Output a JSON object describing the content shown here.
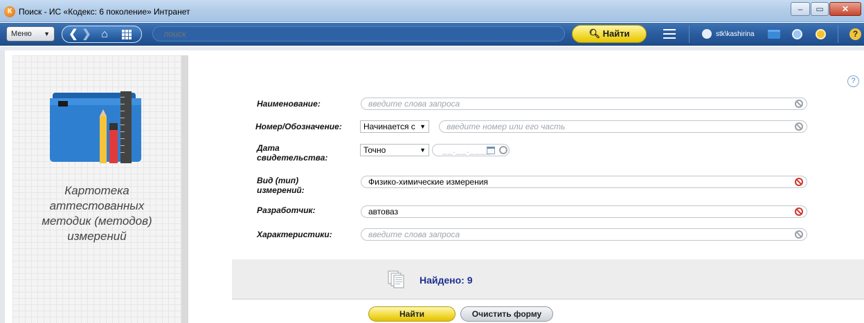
{
  "window": {
    "title": "Поиск - ИС «Кодекс: 6 поколение» Интранет",
    "app_icon_letter": "К"
  },
  "toolbar": {
    "menu_label": "Меню",
    "search_placeholder": "поиск",
    "find_label": "Найти",
    "user_name": "stk\\kashirina",
    "help_symbol": "?"
  },
  "side_panel": {
    "caption_lines": [
      "Картотека",
      "аттестованных",
      "методик (методов)",
      "измерений"
    ]
  },
  "form": {
    "name_label": "Наименование:",
    "name_placeholder": "введите слова запроса",
    "number_label": "Номер/Обозначение:",
    "number_mode": "Начинается с",
    "number_placeholder": "введите номер или его часть",
    "date_label_1": "Дата",
    "date_label_2": "свидетельства:",
    "date_mode": "Точно",
    "date_mask": "__.__.____",
    "kind_label_1": "Вид (тип)",
    "kind_label_2": "измерений:",
    "kind_value": "Физико-химические измерения",
    "developer_label": "Разработчик:",
    "developer_value": "автоваз",
    "characteristics_label": "Характеристики:",
    "characteristics_placeholder": "введите слова запроса"
  },
  "result": {
    "text": "Найдено: 9"
  },
  "actions": {
    "find_label": "Найти",
    "clear_label": "Очистить форму"
  },
  "page_help_symbol": "?"
}
